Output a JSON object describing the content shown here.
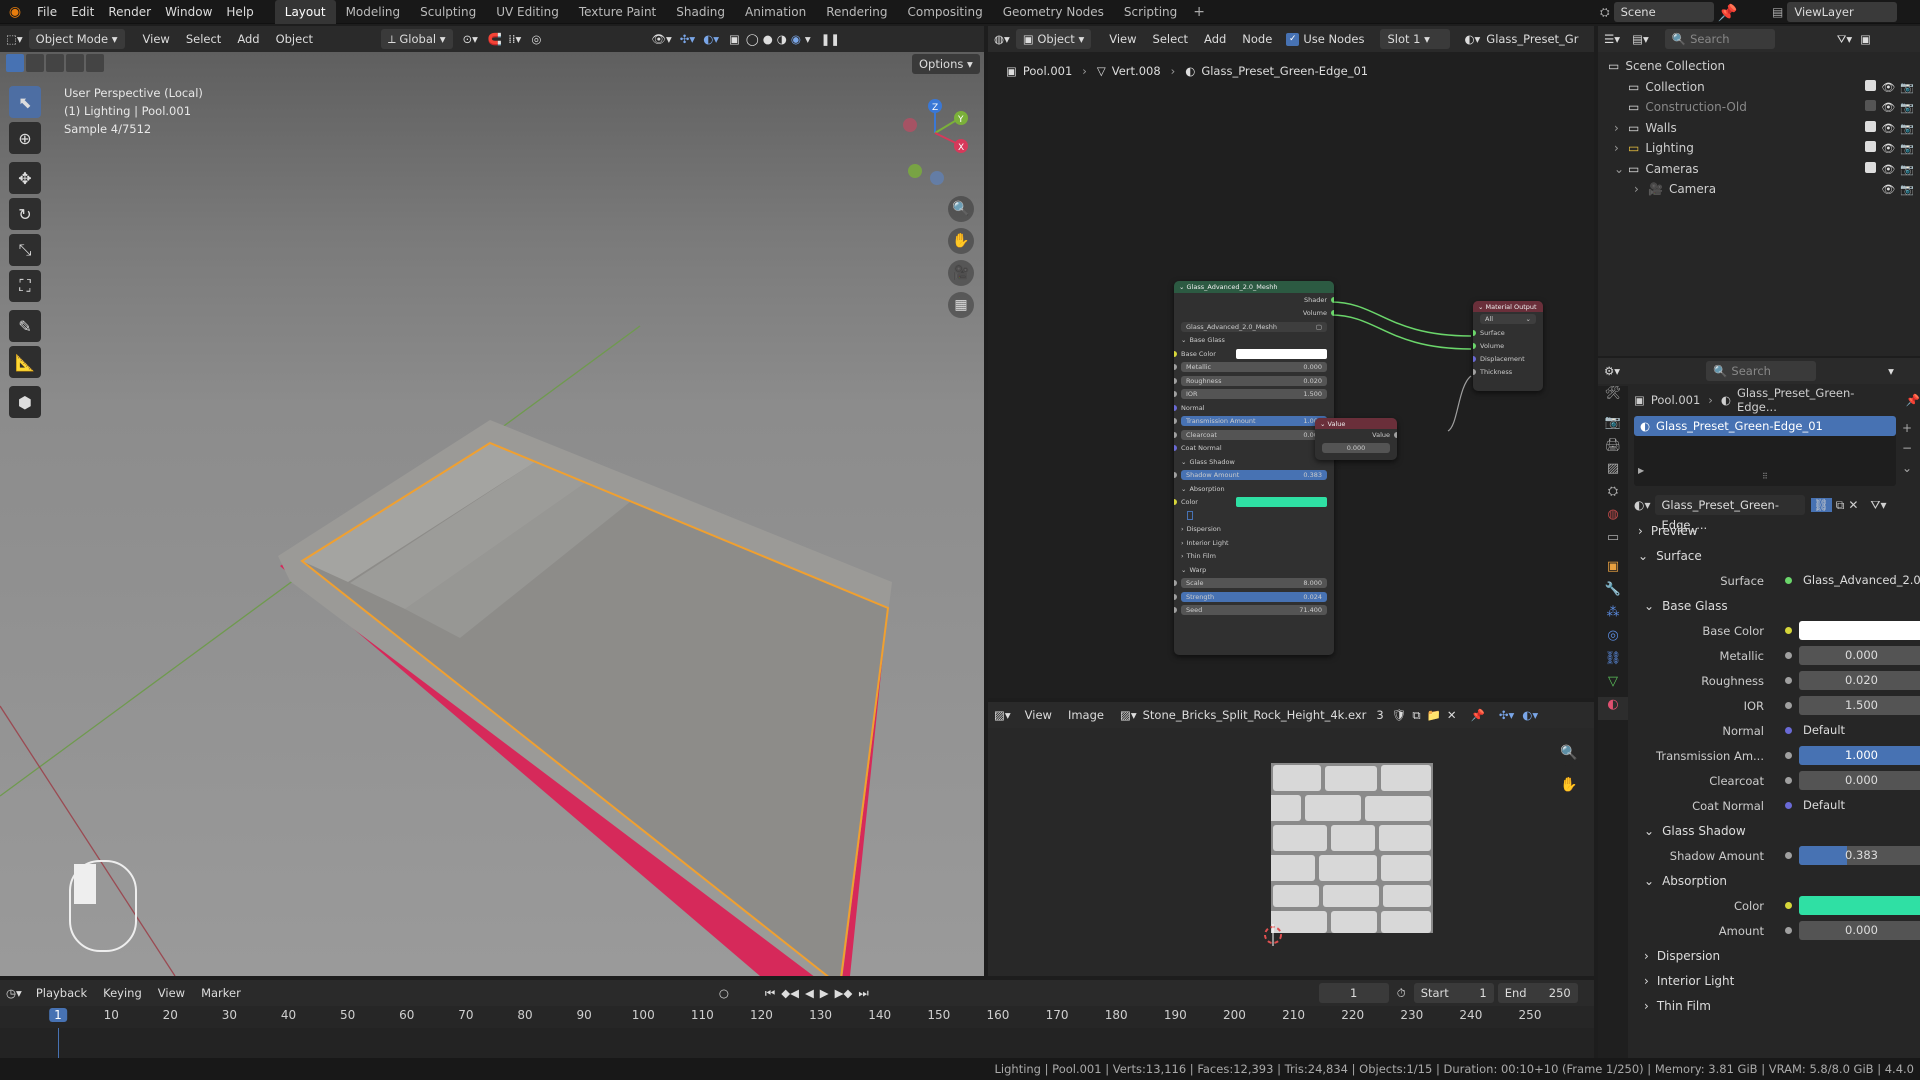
{
  "topbar": {
    "menus": [
      "File",
      "Edit",
      "Render",
      "Window",
      "Help"
    ],
    "workspaces": [
      "Layout",
      "Modeling",
      "Sculpting",
      "UV Editing",
      "Texture Paint",
      "Shading",
      "Animation",
      "Rendering",
      "Compositing",
      "Geometry Nodes",
      "Scripting"
    ],
    "active_workspace": "Layout",
    "scene": "Scene",
    "view_layer": "ViewLayer"
  },
  "viewport": {
    "mode": "Object Mode",
    "menus": [
      "View",
      "Select",
      "Add",
      "Object"
    ],
    "orientation": "Global",
    "options_label": "Options",
    "overlay_lines": [
      "User Perspective (Local)",
      "(1) Lighting | Pool.001",
      "Sample 4/7512"
    ],
    "axes": {
      "x": "X",
      "y": "Y",
      "z": "Z"
    }
  },
  "node_editor": {
    "type": "Object",
    "menus": [
      "View",
      "Select",
      "Add",
      "Node"
    ],
    "use_nodes_label": "Use Nodes",
    "slot": "Slot 1",
    "material_short": "Glass_Preset_Gr",
    "breadcrumb": [
      "Pool.001",
      "Vert.008",
      "Glass_Preset_Green-Edge_01"
    ],
    "group_node": {
      "title": "Glass_Advanced_2.0_Meshh",
      "outputs": [
        "Shader",
        "Volume"
      ],
      "datablock": "Glass_Advanced_2.0_Meshh",
      "rows": [
        {
          "label": "Base Glass",
          "kind": "header"
        },
        {
          "label": "Base Color",
          "kind": "color",
          "color": "#ffffff"
        },
        {
          "label": "Metallic",
          "value": "0.000",
          "kind": "field"
        },
        {
          "label": "Roughness",
          "value": "0.020",
          "kind": "field"
        },
        {
          "label": "IOR",
          "value": "1.500",
          "kind": "field"
        },
        {
          "label": "Normal",
          "kind": "text"
        },
        {
          "label": "Transmission Amount",
          "value": "1.000",
          "kind": "blue"
        },
        {
          "label": "Clearcoat",
          "value": "0.000",
          "kind": "field"
        },
        {
          "label": "Coat Normal",
          "kind": "text"
        },
        {
          "label": "Glass Shadow",
          "kind": "header"
        },
        {
          "label": "Shadow Amount",
          "value": "0.383",
          "kind": "blue"
        },
        {
          "label": "Absorption",
          "kind": "header"
        },
        {
          "label": "Color",
          "kind": "color",
          "color": "#2fe0a4"
        },
        {
          "label": "",
          "kind": "cursor"
        },
        {
          "label": "Dispersion",
          "kind": "sub"
        },
        {
          "label": "Interior Light",
          "kind": "sub"
        },
        {
          "label": "Thin Film",
          "kind": "sub"
        },
        {
          "label": "Warp",
          "kind": "header"
        },
        {
          "label": "Scale",
          "value": "8.000",
          "kind": "field"
        },
        {
          "label": "Strength",
          "value": "0.024",
          "kind": "blue"
        },
        {
          "label": "Seed",
          "value": "71.400",
          "kind": "field"
        }
      ]
    },
    "output_node": {
      "title": "Material Output",
      "target": "All",
      "inputs": [
        "Surface",
        "Volume",
        "Displacement",
        "Thickness"
      ]
    },
    "value_node": {
      "title": "Value",
      "output": "Value",
      "value": "0.000"
    }
  },
  "image_editor": {
    "menus": [
      "View",
      "Image"
    ],
    "image_name": "Stone_Bricks_Split_Rock_Height_4k.exr",
    "users": "3"
  },
  "outliner": {
    "search_placeholder": "Search",
    "items": [
      {
        "label": "Scene Collection",
        "depth": 0
      },
      {
        "label": "Collection",
        "depth": 1
      },
      {
        "label": "Construction-Old",
        "depth": 1
      },
      {
        "label": "Walls",
        "depth": 1
      },
      {
        "label": "Lighting",
        "depth": 1
      },
      {
        "label": "Cameras",
        "depth": 1
      },
      {
        "label": "Camera",
        "depth": 2
      }
    ]
  },
  "properties": {
    "search_placeholder": "Search",
    "breadcrumb": [
      "Pool.001",
      "Glass_Preset_Green-Edge..."
    ],
    "slot_item": "Glass_Preset_Green-Edge_01",
    "material_field": "Glass_Preset_Green-Edge_...",
    "sections": {
      "preview": "Preview",
      "surface": "Surface",
      "base_glass": "Base Glass",
      "glass_shadow": "Glass Shadow",
      "absorption": "Absorption",
      "dispersion": "Dispersion",
      "interior_light": "Interior Light",
      "thin_film": "Thin Film"
    },
    "surface_label": "Surface",
    "surface_value": "Glass_Advanced_2.0_I...",
    "base_color_label": "Base Color",
    "metallic": {
      "label": "Metallic",
      "value": "0.000"
    },
    "roughness": {
      "label": "Roughness",
      "value": "0.020"
    },
    "ior": {
      "label": "IOR",
      "value": "1.500"
    },
    "normal": {
      "label": "Normal",
      "value": "Default"
    },
    "transmission": {
      "label": "Transmission Am...",
      "value": "1.000"
    },
    "clearcoat": {
      "label": "Clearcoat",
      "value": "0.000"
    },
    "coat_normal": {
      "label": "Coat Normal",
      "value": "Default"
    },
    "shadow_amount": {
      "label": "Shadow Amount",
      "value": "0.383",
      "fraction": 0.383
    },
    "abs_color": {
      "label": "Color",
      "color": "#2fe0a4"
    },
    "amount": {
      "label": "Amount",
      "value": "0.000"
    }
  },
  "timeline": {
    "menus": [
      "Playback",
      "Keying",
      "View",
      "Marker"
    ],
    "current_frame": "1",
    "start_label": "Start",
    "start": "1",
    "end_label": "End",
    "end": "250",
    "ticks": [
      "1",
      "10",
      "20",
      "30",
      "40",
      "50",
      "60",
      "70",
      "80",
      "90",
      "100",
      "110",
      "120",
      "130",
      "140",
      "150",
      "160",
      "170",
      "180",
      "190",
      "200",
      "210",
      "220",
      "230",
      "240",
      "250"
    ]
  },
  "status": "Lighting | Pool.001 | Verts:13,116 | Faces:12,393 | Tris:24,834 | Objects:1/15 | Duration: 00:10+10 (Frame 1/250) | Memory: 3.81 GiB | VRAM: 5.8/8.0 GiB | 4.4.0",
  "colors": {
    "accent": "#4772b3",
    "selected_outline": "#f0a030",
    "pool_side": "#e8344a",
    "absorption": "#2fe0a4"
  }
}
